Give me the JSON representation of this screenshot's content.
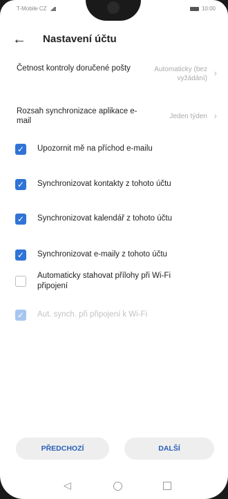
{
  "status_bar": {
    "carrier": "T-Mobile CZ",
    "time": "10:00"
  },
  "header": {
    "title": "Nastavení účtu"
  },
  "settings": [
    {
      "label": "Četnost kontroly doručené pošty",
      "value": "Automaticky (bez vyžádání)"
    },
    {
      "label": "Rozsah synchronizace aplikace e-mail",
      "value": "Jeden týden"
    }
  ],
  "checks": [
    {
      "label": "Upozornit mě na příchod e-mailu",
      "checked": true
    },
    {
      "label": "Synchronizovat kontakty z tohoto účtu",
      "checked": true
    },
    {
      "label": "Synchronizovat kalendář z tohoto účtu",
      "checked": true
    },
    {
      "label": "Synchronizovat e-maily z tohoto účtu",
      "checked": true
    },
    {
      "label": "Automaticky stahovat přílohy při Wi-Fi připojení",
      "checked": false
    },
    {
      "label": "Aut. synch. při připojení k Wi-Fi",
      "checked": true,
      "disabled": true
    }
  ],
  "buttons": {
    "prev": "PŘEDCHOZÍ",
    "next": "DALŠÍ"
  },
  "icons": {
    "back": "arrow-left-icon",
    "chevron": "chevron-right-icon",
    "nav_back": "triangle-back-icon",
    "nav_home": "circle-home-icon",
    "nav_recent": "square-recent-icon"
  },
  "colors": {
    "accent": "#2f74d6",
    "button_text": "#2a60b8",
    "muted": "#aaaaaa"
  }
}
